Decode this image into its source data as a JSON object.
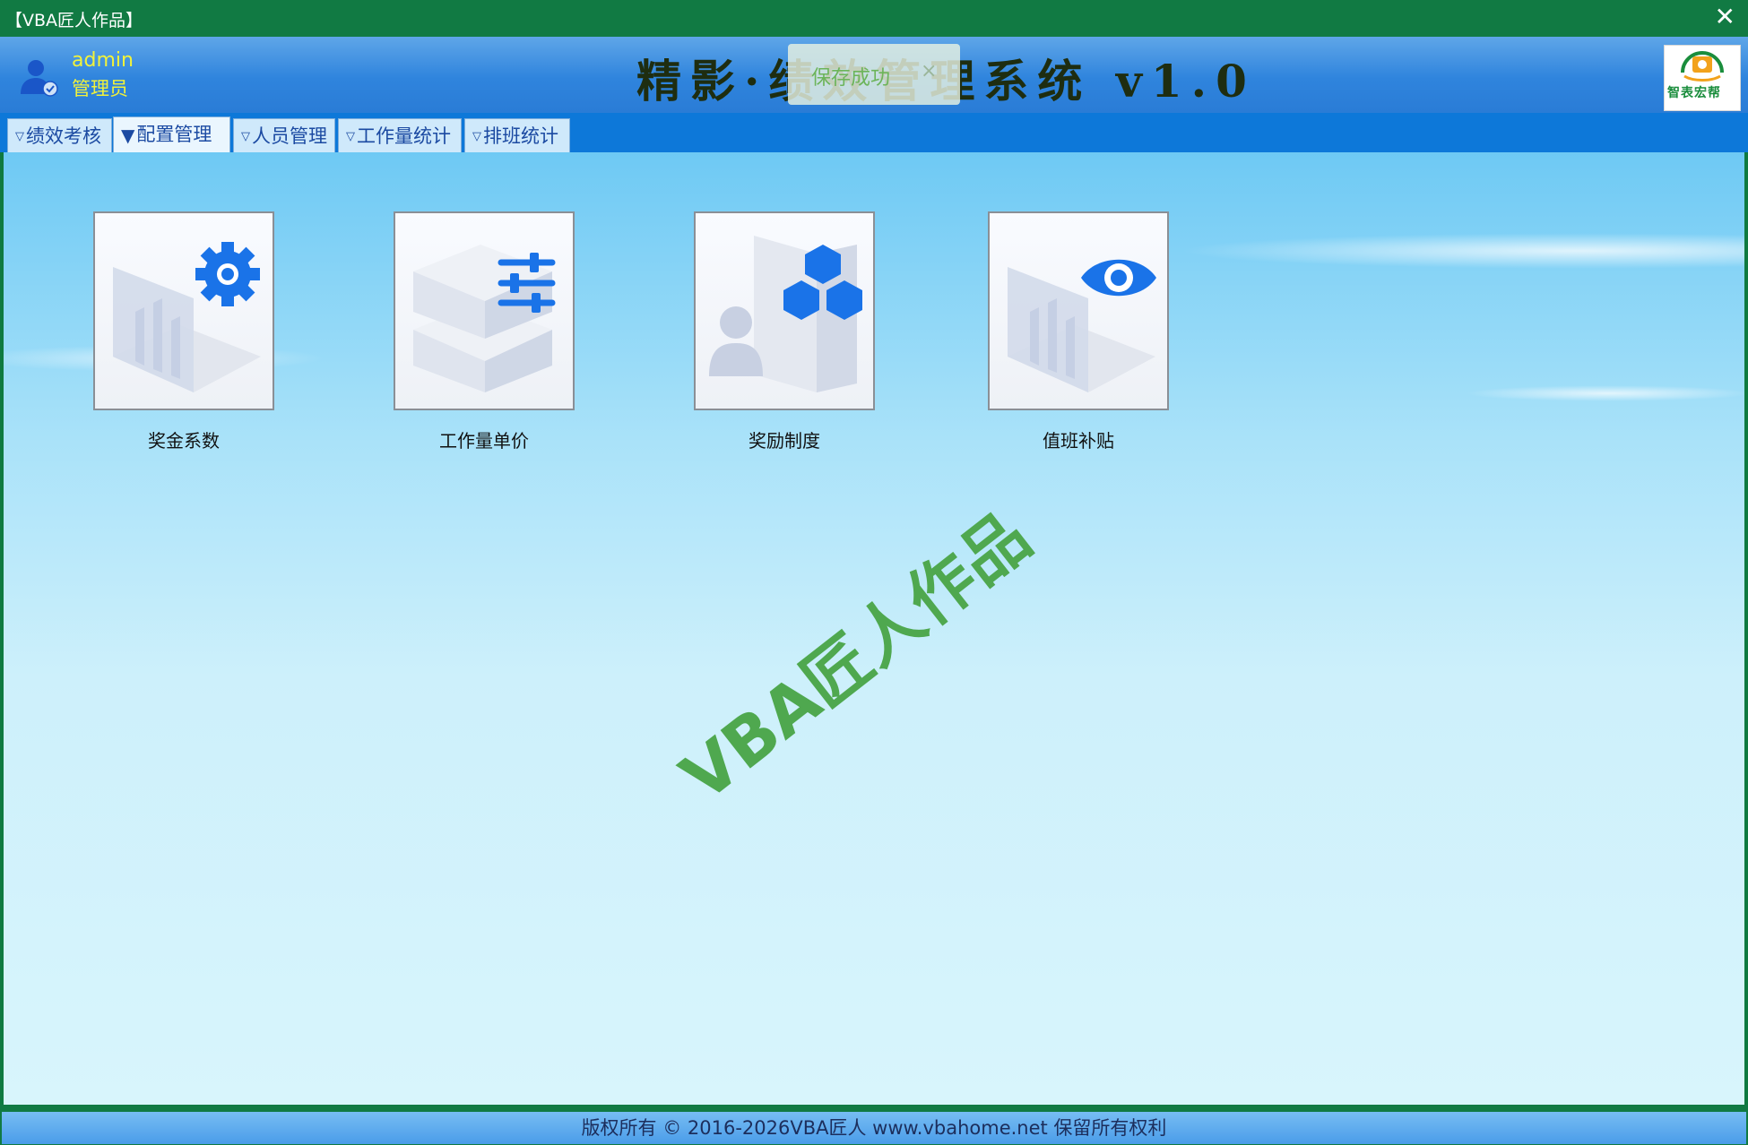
{
  "window": {
    "title": "【VBA匠人作品】",
    "close_glyph": "✕"
  },
  "header": {
    "user_name": "admin",
    "user_role": "管理员",
    "app_title": "精影·绩效管理系统 v1.0",
    "logo_text": "智表宏帮"
  },
  "toast": {
    "message": "保存成功",
    "close_glyph": "×"
  },
  "tabs": [
    {
      "arrow": "▽",
      "label": "绩效考核",
      "active": false
    },
    {
      "arrow": "▼",
      "label": "配置管理",
      "active": true
    },
    {
      "arrow": "▽",
      "label": "人员管理",
      "active": false
    },
    {
      "arrow": "▽",
      "label": "工作量统计",
      "active": false
    },
    {
      "arrow": "▽",
      "label": "排班统计",
      "active": false
    }
  ],
  "tiles": [
    {
      "label": "奖金系数",
      "icon": "bonus-coefficient-icon"
    },
    {
      "label": "工作量单价",
      "icon": "workload-price-icon"
    },
    {
      "label": "奖励制度",
      "icon": "reward-policy-icon"
    },
    {
      "label": "值班补贴",
      "icon": "duty-allowance-icon"
    }
  ],
  "watermark": "VBA匠人作品",
  "footer": {
    "copyright": "版权所有 © 2016-2026VBA匠人 www.vbahome.net 保留所有权利"
  },
  "colors": {
    "accent_green": "#117a43",
    "tab_blue": "#0d78d9",
    "icon_blue": "#1a73e8",
    "user_text": "#f2f23a"
  }
}
